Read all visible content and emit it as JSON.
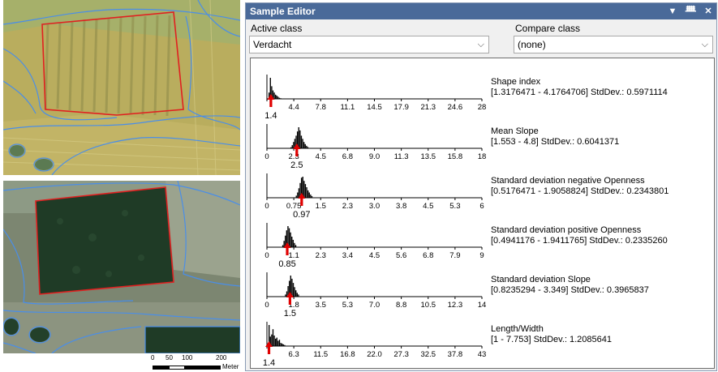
{
  "window": {
    "title": "Sample Editor",
    "controls": {
      "dropdown": "▼",
      "pin": "ᚙ",
      "close": "✕"
    }
  },
  "active_class": {
    "label": "Active class",
    "value": "Verdacht"
  },
  "compare_class": {
    "label": "Compare class",
    "value": "(none)"
  },
  "scalebar": {
    "labels": [
      "0",
      "50",
      "100",
      "200"
    ],
    "unit": "Meter"
  },
  "features": [
    {
      "name": "Shape index",
      "stats": "[1.3176471 - 4.1764706] StdDev.: 0.5971114",
      "ticks": [
        "",
        "4.4",
        "7.8",
        "11.1",
        "14.5",
        "17.9",
        "21.3",
        "24.6",
        "28"
      ],
      "mean": "1.4",
      "axis_min": 0.9,
      "axis_max": 28,
      "mean_value": 1.4,
      "bins": [
        0.3,
        1.0,
        0.6,
        0.4,
        0.3,
        0.2,
        0.15,
        0.1,
        0.05,
        0.03
      ]
    },
    {
      "name": "Mean Slope",
      "stats": "[1.553 - 4.8] StdDev.: 0.6041371",
      "ticks": [
        "0",
        "2.3",
        "4.5",
        "6.8",
        "9.0",
        "11.3",
        "13.5",
        "15.8",
        "18"
      ],
      "mean": "2.5",
      "axis_min": 0,
      "axis_max": 18,
      "mean_value": 2.5,
      "bins": [
        0.05,
        0.15,
        0.3,
        0.45,
        0.6,
        0.8,
        1.0,
        0.85,
        0.6,
        0.45,
        0.3,
        0.2,
        0.12,
        0.06
      ]
    },
    {
      "name": "Standard deviation negative Openness",
      "stats": "[0.5176471 - 1.9058824] StdDev.: 0.2343801",
      "ticks": [
        "0",
        "0.75",
        "1.5",
        "2.3",
        "3.0",
        "3.8",
        "4.5",
        "5.3",
        "6"
      ],
      "mean": "0.97",
      "axis_min": 0,
      "axis_max": 6,
      "mean_value": 0.97,
      "bins": [
        0.1,
        0.25,
        0.45,
        0.7,
        0.95,
        1.0,
        0.8,
        0.65,
        0.5,
        0.35,
        0.25,
        0.15,
        0.08
      ]
    },
    {
      "name": "Standard deviation positive Openness",
      "stats": "[0.4941176 - 1.9411765] StdDev.: 0.2335260",
      "ticks": [
        "0",
        "1.1",
        "2.3",
        "3.4",
        "4.5",
        "5.6",
        "6.8",
        "7.9",
        "9"
      ],
      "mean": "0.85",
      "axis_min": 0,
      "axis_max": 9,
      "mean_value": 0.85,
      "bins": [
        0.1,
        0.3,
        0.55,
        0.8,
        1.0,
        0.9,
        0.7,
        0.5,
        0.35,
        0.2,
        0.1
      ]
    },
    {
      "name": "Standard deviation Slope",
      "stats": "[0.8235294 - 3.349] StdDev.: 0.3965837",
      "ticks": [
        "0",
        "1.8",
        "3.5",
        "5.3",
        "7.0",
        "8.8",
        "10.5",
        "12.3",
        "14"
      ],
      "mean": "1.5",
      "axis_min": 0,
      "axis_max": 14,
      "mean_value": 1.5,
      "bins": [
        0.1,
        0.25,
        0.5,
        0.75,
        1.0,
        0.85,
        0.65,
        0.45,
        0.3,
        0.18,
        0.1
      ]
    },
    {
      "name": "Length/Width",
      "stats": "[1 - 7.753] StdDev.: 1.2085641",
      "ticks": [
        "",
        "6.3",
        "11.5",
        "16.8",
        "22.0",
        "27.3",
        "32.5",
        "37.8",
        "43"
      ],
      "mean": "1.4",
      "axis_min": 1,
      "axis_max": 43,
      "mean_value": 1.4,
      "bins": [
        1.0,
        0.45,
        0.55,
        0.8,
        0.5,
        0.35,
        0.4,
        0.25,
        0.3,
        0.15,
        0.12,
        0.08,
        0.05
      ]
    }
  ],
  "colors": {
    "titlebar": "#4a6a99",
    "bars": "#000000",
    "mean_arrow": "#e00000",
    "outline_red": "#e02020",
    "outline_blue": "#4a8ee8"
  }
}
